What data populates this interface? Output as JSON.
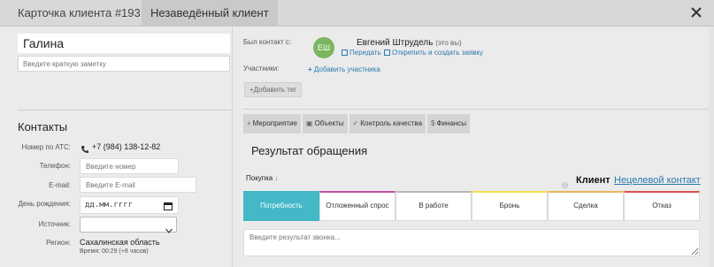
{
  "header": {
    "title": "Карточка клиента #193",
    "status_tag": "Незаведённый клиент"
  },
  "client": {
    "name": "Галина",
    "note_placeholder": "Введите краткую заметку"
  },
  "contacts": {
    "title": "Контакты",
    "ats_label": "Номер по АТС:",
    "ats_value": "+7 (984) 138-12-82",
    "phone_label": "Телефон:",
    "phone_placeholder": "Введите номер",
    "email_label": "E-mail:",
    "email_placeholder": "Введите E-mail",
    "birthday_label": "День рождения:",
    "birthday_value": "дд.мм.гггг",
    "source_label": "Источник:",
    "region_label": "Регион:",
    "region_value": "Сахалинская область",
    "region_time": "Время: 00:29 (+8 часов)"
  },
  "contact_info": {
    "was_contact_label": "Был контакт с:",
    "avatar_initials": "ЕШ",
    "agent_name": "Евгений Штрудель",
    "agent_you": "(это вы)",
    "transfer_link": "Передать",
    "unpin_link": "Открепить и создать заявку",
    "participants_label": "Участники:",
    "add_participant": "Добавить участника",
    "add_tag": "Добавить тег"
  },
  "tabs": [
    {
      "icon": "+",
      "label": "Мероприятие"
    },
    {
      "icon": "▣",
      "label": "Объекты"
    },
    {
      "icon": "✓",
      "label": "Контроль качества"
    },
    {
      "icon": "$",
      "label": "Финансы"
    }
  ],
  "result": {
    "title": "Результат обращения",
    "type": "Покупка",
    "client_label": "Клиент",
    "nontarget_link": "Нецелевой контакт",
    "stages": [
      {
        "label": "Потребность",
        "color": "#44b8c6",
        "active": true
      },
      {
        "label": "Отложенный спрос",
        "color": "#c24fa8",
        "active": false
      },
      {
        "label": "В работе",
        "color": "#b7b7b7",
        "active": false
      },
      {
        "label": "Бронь",
        "color": "#f2e34b",
        "active": false
      },
      {
        "label": "Сделка",
        "color": "#e8b85a",
        "active": false
      },
      {
        "label": "Отказ",
        "color": "#d9534f",
        "active": false
      }
    ],
    "comment_placeholder": "Введите результат звонка..."
  }
}
